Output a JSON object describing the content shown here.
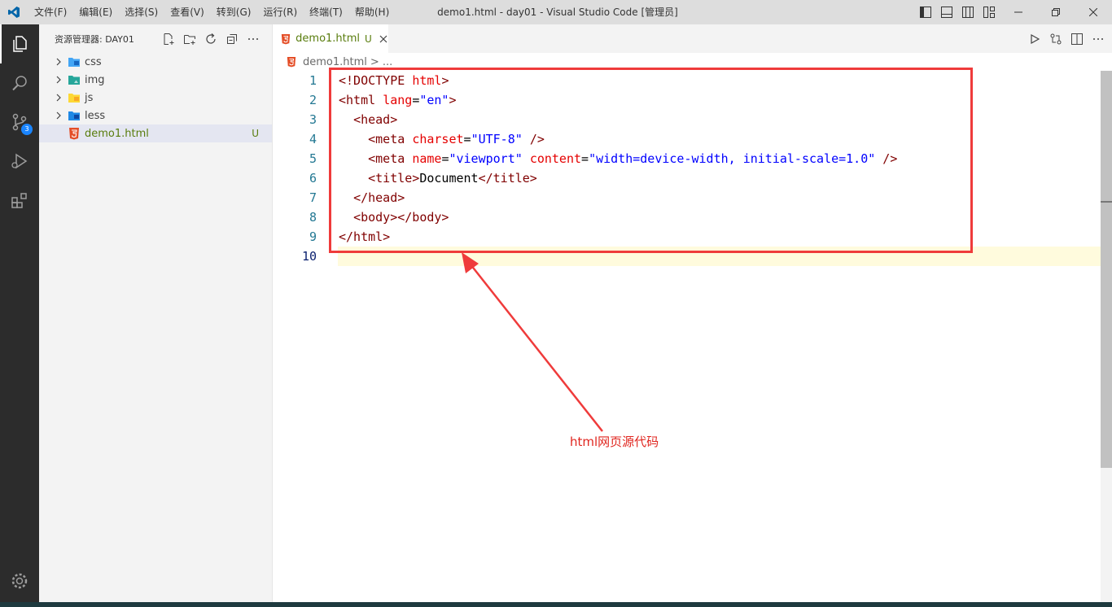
{
  "titlebar": {
    "menu": [
      "文件(F)",
      "编辑(E)",
      "选择(S)",
      "查看(V)",
      "转到(G)",
      "运行(R)",
      "终端(T)",
      "帮助(H)"
    ],
    "window_title": "demo1.html - day01 - Visual Studio Code [管理员]"
  },
  "activity": {
    "scm_badge": "3"
  },
  "sidebar": {
    "title": "资源管理器: DAY01",
    "items": [
      {
        "label": "css",
        "type": "folder",
        "icon": "css-folder-icon"
      },
      {
        "label": "img",
        "type": "folder",
        "icon": "img-folder-icon"
      },
      {
        "label": "js",
        "type": "folder",
        "icon": "js-folder-icon"
      },
      {
        "label": "less",
        "type": "folder",
        "icon": "less-folder-icon"
      },
      {
        "label": "demo1.html",
        "type": "file",
        "icon": "html5-icon",
        "status": "U"
      }
    ]
  },
  "tab": {
    "label": "demo1.html",
    "status": "U"
  },
  "breadcrumbs": {
    "file": "demo1.html",
    "sep": "> ..."
  },
  "editor": {
    "line_numbers": [
      "1",
      "2",
      "3",
      "4",
      "5",
      "6",
      "7",
      "8",
      "9",
      "10"
    ],
    "current_line": 10
  },
  "annotation": {
    "label": "html网页源代码",
    "color": "#ef3b3b"
  },
  "colors": {
    "activitybar": "#2c2c2c",
    "sidebar": "#f3f3f3",
    "untracked": "#587c0c",
    "accent": "#1a85ff"
  }
}
